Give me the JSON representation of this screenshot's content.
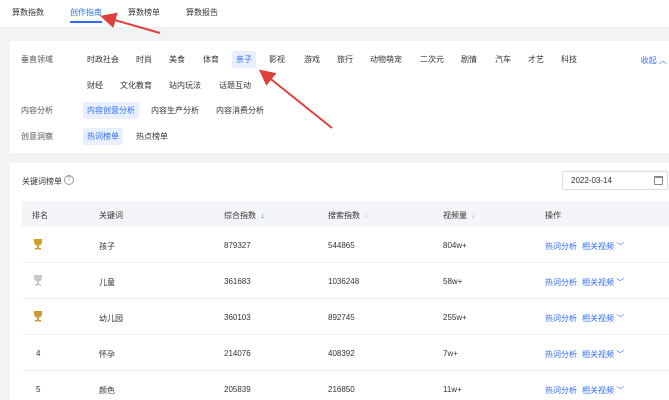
{
  "tabs": [
    {
      "label": "算数指数"
    },
    {
      "label": "创作指南"
    },
    {
      "label": "算数榜单"
    },
    {
      "label": "算数报告"
    }
  ],
  "filter": {
    "vertical_label": "垂直领域",
    "collapse_label": "收起",
    "verticals_row1": [
      "时政社会",
      "时尚",
      "美食",
      "体育",
      "亲子",
      "影视",
      "游戏",
      "旅行",
      "动物萌宠",
      "二次元",
      "剧情",
      "汽车",
      "才艺",
      "科技"
    ],
    "verticals_row2": [
      "财经",
      "文化教育",
      "站内玩法",
      "话题互动"
    ],
    "selected_vertical": "亲子",
    "analysis_label": "内容分析",
    "analysis_options": [
      "内容创意分析",
      "内容生产分析",
      "内容消费分析"
    ],
    "selected_analysis": "内容创意分析",
    "insight_label": "创意洞察",
    "insight_options": [
      "热词榜单",
      "热点榜单"
    ],
    "selected_insight": "热词榜单"
  },
  "list": {
    "title": "关键词榜单",
    "date": "2022-03-14",
    "columns": {
      "rank": "排名",
      "keyword": "关键词",
      "composite": "综合指数",
      "search": "搜索指数",
      "video": "视频量",
      "action": "操作"
    },
    "action_1": "热词分析",
    "action_2": "相关视频",
    "rows": [
      {
        "rank": "",
        "keyword": "孩子",
        "composite": "879327",
        "search": "544865",
        "video": "804w+",
        "medal": "gold"
      },
      {
        "rank": "",
        "keyword": "儿童",
        "composite": "361683",
        "search": "1036248",
        "video": "58w+",
        "medal": "silver"
      },
      {
        "rank": "",
        "keyword": "幼儿园",
        "composite": "360103",
        "search": "892745",
        "video": "255w+",
        "medal": "bronze"
      },
      {
        "rank": "4",
        "keyword": "怀孕",
        "composite": "214076",
        "search": "408392",
        "video": "7w+",
        "medal": ""
      },
      {
        "rank": "5",
        "keyword": "颜色",
        "composite": "205839",
        "search": "216850",
        "video": "11w+",
        "medal": ""
      }
    ]
  },
  "colors": {
    "accent": "#2f6bff",
    "arrow": "#e0403a",
    "gold": "#c9a227",
    "silver": "#c4c7cc",
    "bronze": "#c99b3a"
  }
}
